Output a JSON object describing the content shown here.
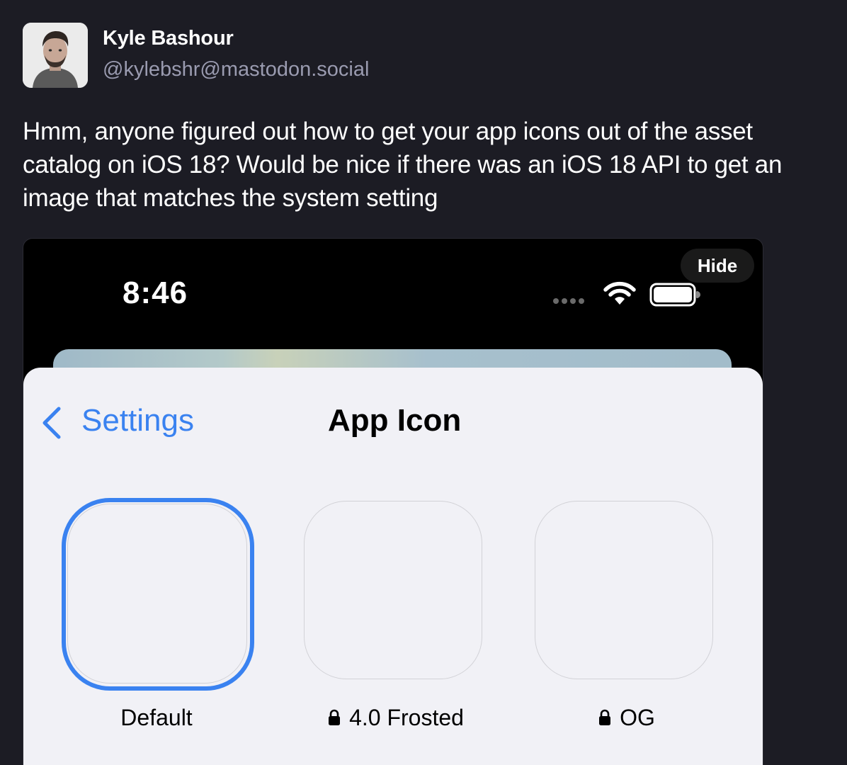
{
  "author": {
    "name": "Kyle Bashour",
    "handle": "@kylebshr@mastodon.social"
  },
  "post": {
    "text": "Hmm, anyone figured out how to get your app icons out of the asset catalog on iOS 18? Would be nice if there was an iOS 18 API to get an image that matches the system setting"
  },
  "media": {
    "hide_label": "Hide",
    "status_bar": {
      "time": "8:46",
      "icons": [
        "signal-dots-icon",
        "wifi-icon",
        "battery-icon"
      ]
    },
    "nav": {
      "back_label": "Settings",
      "title": "App Icon"
    },
    "app_icons": [
      {
        "label": "Default",
        "selected": true,
        "locked": false
      },
      {
        "label": "4.0 Frosted",
        "selected": false,
        "locked": true
      },
      {
        "label": "OG",
        "selected": false,
        "locked": true
      }
    ],
    "colors": {
      "accent": "#3a82f0",
      "sheet_background": "#f1f1f6",
      "page_background": "#1c1c24"
    }
  }
}
